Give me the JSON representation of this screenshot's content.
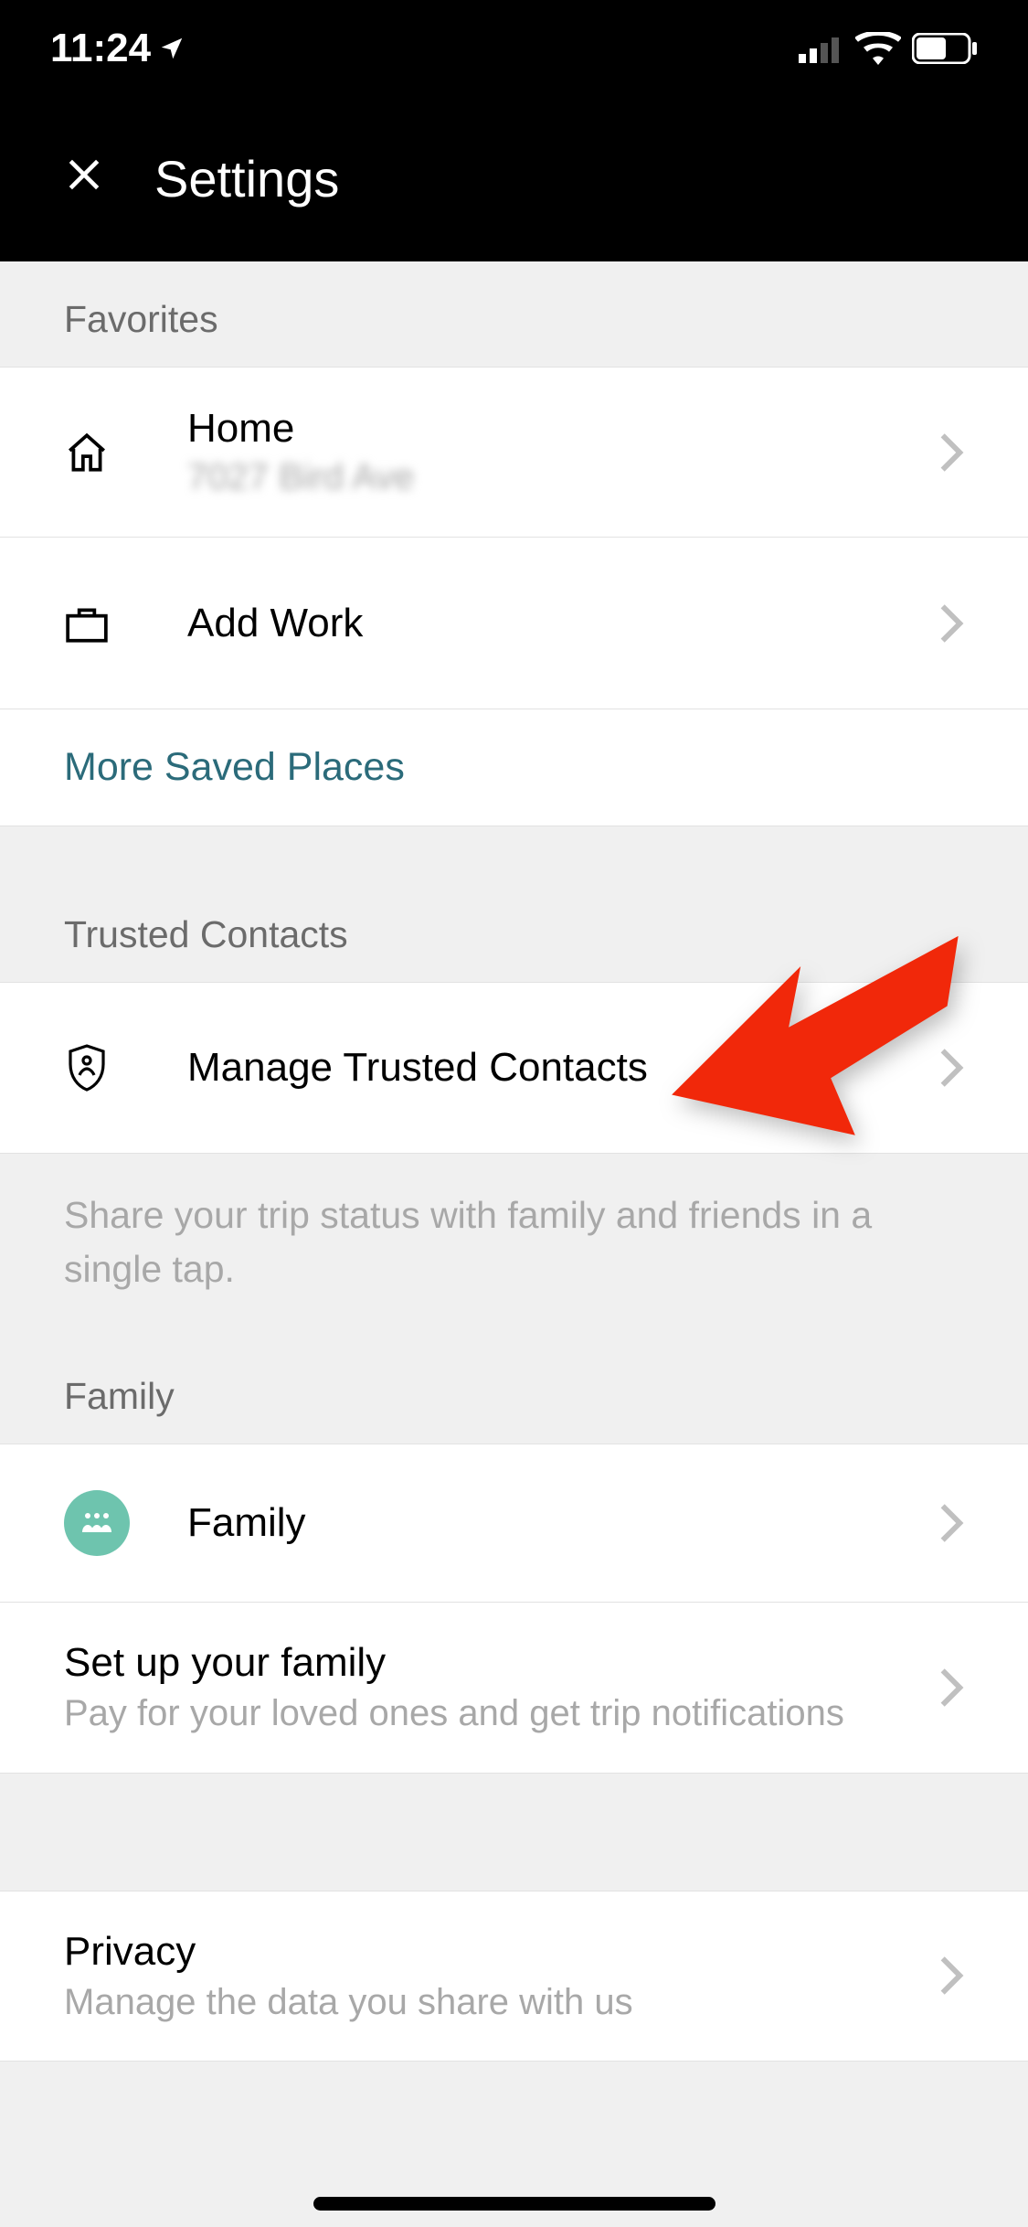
{
  "status": {
    "time": "11:24"
  },
  "header": {
    "title": "Settings"
  },
  "sections": {
    "favorites": {
      "label": "Favorites",
      "home": {
        "title": "Home",
        "subtitle": "7027 Bird Ave"
      },
      "add_work": {
        "title": "Add Work"
      },
      "more_link": "More Saved Places"
    },
    "trusted": {
      "label": "Trusted Contacts",
      "manage": {
        "title": "Manage Trusted Contacts"
      },
      "description": "Share your trip status with family and friends in a single tap."
    },
    "family": {
      "label": "Family",
      "family_row": {
        "title": "Family"
      },
      "setup": {
        "title": "Set up your family",
        "subtitle": "Pay for your loved ones and get trip notifications"
      }
    },
    "privacy": {
      "title": "Privacy",
      "subtitle": "Manage the data you share with us"
    }
  }
}
